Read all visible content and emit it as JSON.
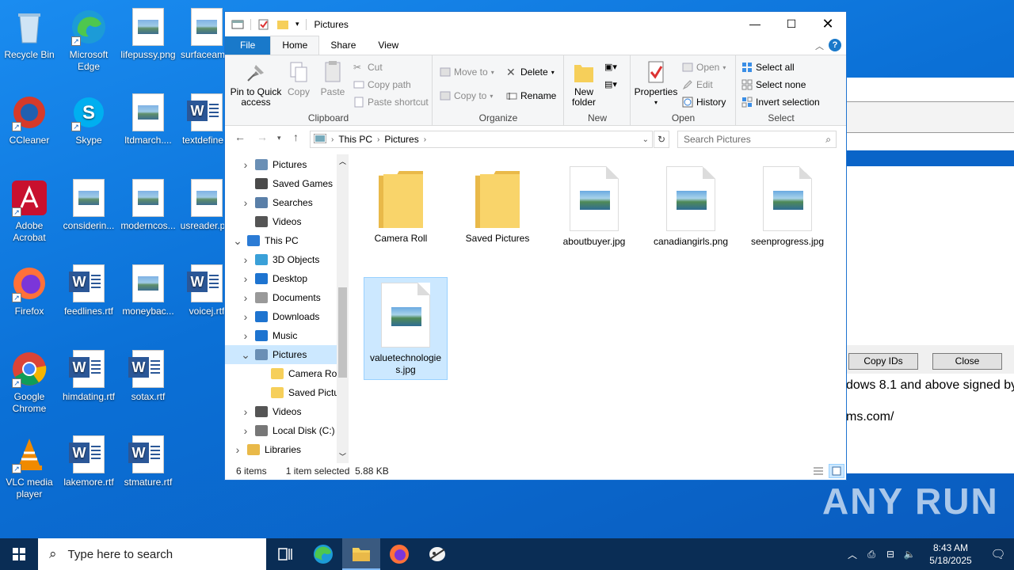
{
  "desktop": {
    "icons": [
      {
        "label": "Recycle Bin"
      },
      {
        "label": "Microsoft Edge"
      },
      {
        "label": "lifepussy.png"
      },
      {
        "label": "surfaceam..."
      },
      {
        "label": "CCleaner"
      },
      {
        "label": "Skype"
      },
      {
        "label": "ltdmarch...."
      },
      {
        "label": "textdefine..."
      },
      {
        "label": "Adobe Acrobat"
      },
      {
        "label": "considerin..."
      },
      {
        "label": "moderncos..."
      },
      {
        "label": "usreader.p..."
      },
      {
        "label": "Firefox"
      },
      {
        "label": "feedlines.rtf"
      },
      {
        "label": "moneybac..."
      },
      {
        "label": "voicej.rtf"
      },
      {
        "label": "Google Chrome"
      },
      {
        "label": "himdating.rtf"
      },
      {
        "label": "sotax.rtf"
      },
      {
        "label": "VLC media player"
      },
      {
        "label": "lakemore.rtf"
      },
      {
        "label": "stmature.rtf"
      }
    ]
  },
  "bg_window": {
    "copy_ids_label": "Copy IDs",
    "close_label": "Close",
    "text1": "dows 8.1 and above signed by",
    "text2": "ms.com/"
  },
  "explorer": {
    "title": "Pictures",
    "tabs": [
      "File",
      "Home",
      "Share",
      "View"
    ],
    "ribbon": {
      "clipboard": {
        "title": "Clipboard",
        "pin": "Pin to Quick access",
        "copy": "Copy",
        "paste": "Paste",
        "cut": "Cut",
        "copy_path": "Copy path",
        "paste_shortcut": "Paste shortcut"
      },
      "organize": {
        "title": "Organize",
        "move_to": "Move to",
        "copy_to": "Copy to",
        "delete": "Delete",
        "rename": "Rename"
      },
      "new": {
        "title": "New",
        "new_folder": "New folder"
      },
      "open": {
        "title": "Open",
        "properties": "Properties",
        "open": "Open",
        "edit": "Edit",
        "history": "History"
      },
      "select": {
        "title": "Select",
        "select_all": "Select all",
        "select_none": "Select none",
        "invert": "Invert selection"
      }
    },
    "address": {
      "crumbs": [
        "This PC",
        "Pictures"
      ],
      "search_placeholder": "Search Pictures"
    },
    "nav": [
      {
        "label": "Pictures",
        "indent": 1,
        "chev": ">"
      },
      {
        "label": "Saved Games",
        "indent": 1,
        "chev": ""
      },
      {
        "label": "Searches",
        "indent": 1,
        "chev": ">"
      },
      {
        "label": "Videos",
        "indent": 1,
        "chev": ""
      },
      {
        "label": "This PC",
        "indent": 0,
        "chev": "v"
      },
      {
        "label": "3D Objects",
        "indent": 1,
        "chev": ">"
      },
      {
        "label": "Desktop",
        "indent": 1,
        "chev": ">"
      },
      {
        "label": "Documents",
        "indent": 1,
        "chev": ">"
      },
      {
        "label": "Downloads",
        "indent": 1,
        "chev": ">"
      },
      {
        "label": "Music",
        "indent": 1,
        "chev": ">"
      },
      {
        "label": "Pictures",
        "indent": 1,
        "chev": "v"
      },
      {
        "label": "Camera Roll",
        "indent": 2,
        "chev": ""
      },
      {
        "label": "Saved Picture",
        "indent": 2,
        "chev": ""
      },
      {
        "label": "Videos",
        "indent": 1,
        "chev": ">"
      },
      {
        "label": "Local Disk (C:)",
        "indent": 1,
        "chev": ">"
      },
      {
        "label": "Libraries",
        "indent": 0,
        "chev": ">"
      }
    ],
    "files": [
      {
        "name": "Camera Roll",
        "kind": "folder"
      },
      {
        "name": "Saved Pictures",
        "kind": "folder"
      },
      {
        "name": "aboutbuyer.jpg",
        "kind": "image"
      },
      {
        "name": "canadiangirls.png",
        "kind": "image"
      },
      {
        "name": "seenprogress.jpg",
        "kind": "image"
      },
      {
        "name": "valuetechnologies.jpg",
        "kind": "image"
      }
    ],
    "status": {
      "count": "6 items",
      "selected": "1 item selected  5.88 KB"
    }
  },
  "taskbar": {
    "search_placeholder": "Type here to search",
    "time": "8:43 AM",
    "date": "5/18/2025"
  },
  "watermark": "ANY RUN"
}
